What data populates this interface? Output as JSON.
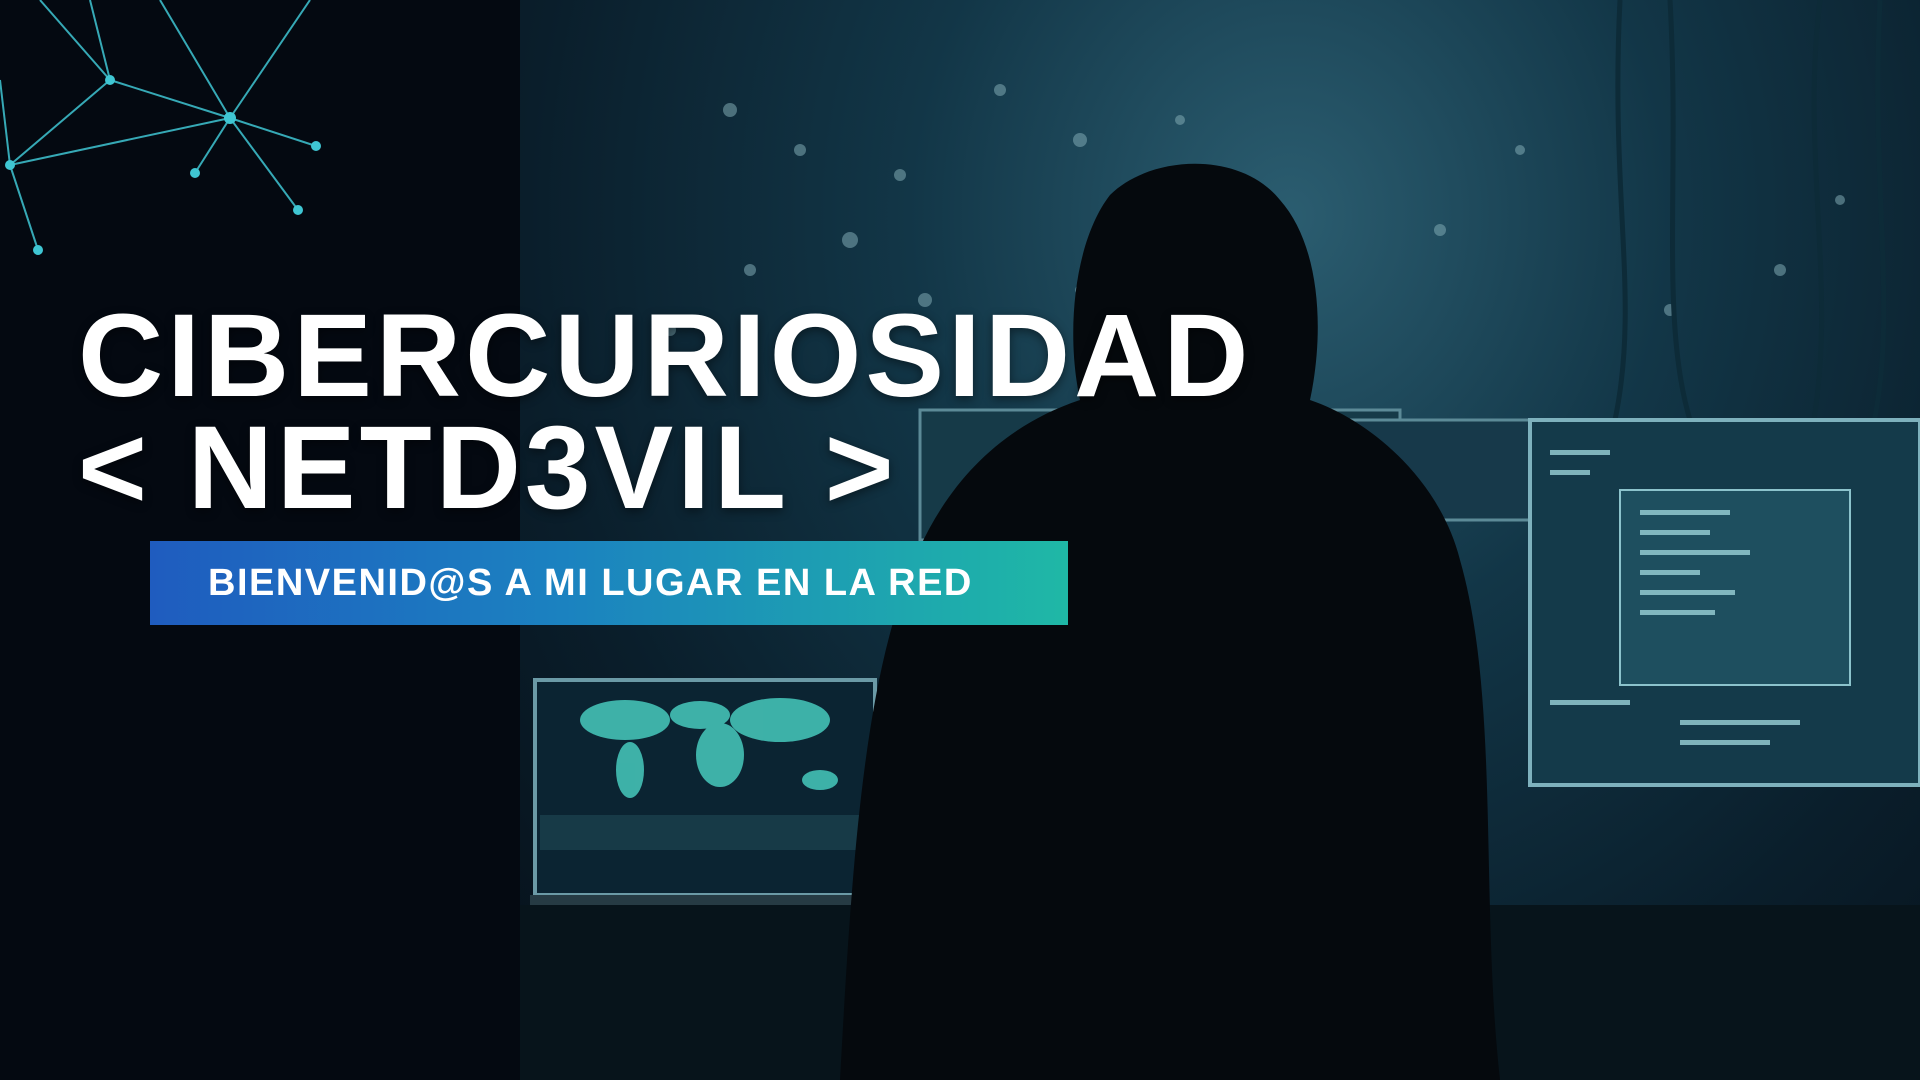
{
  "hero": {
    "title_line1": "CIBERCURIOSIDAD",
    "title_line2": "< NETD3VIL >",
    "tagline": "BIENVENID@S A MI LUGAR EN LA RED"
  },
  "theme": {
    "left_panel": "#040911",
    "banner_gradient": [
      "#1f5cbf",
      "#1fb8a6"
    ],
    "network_color": "#3fc6d3",
    "title_color": "#ffffff"
  },
  "images": {
    "background": "hooded-hacker-at-computer-monitors",
    "decoration": "network-nodes-icon"
  }
}
